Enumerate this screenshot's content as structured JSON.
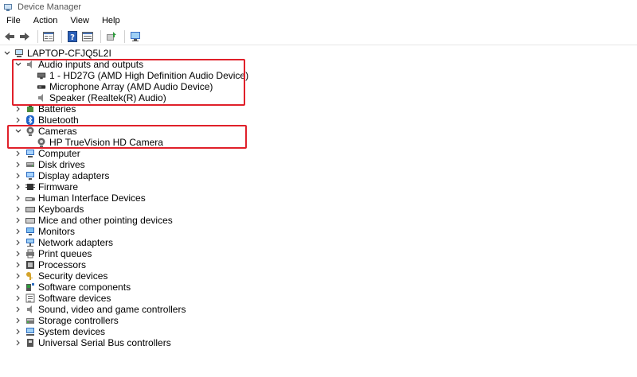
{
  "window": {
    "title": "Device Manager"
  },
  "menu": {
    "items": [
      "File",
      "Action",
      "View",
      "Help"
    ]
  },
  "toolbar": {
    "buttons": [
      "back-icon",
      "forward-icon",
      "properties-icon",
      "help-icon",
      "scan-icon",
      "update-driver-icon",
      "monitor-icon"
    ]
  },
  "tree": {
    "root": "LAPTOP-CFJQ5L2I",
    "audio": {
      "label": "Audio inputs and outputs",
      "children": [
        "1 - HD27G (AMD High Definition Audio Device)",
        "Microphone Array (AMD Audio Device)",
        "Speaker (Realtek(R) Audio)"
      ]
    },
    "batteries": "Batteries",
    "bluetooth": "Bluetooth",
    "cameras": {
      "label": "Cameras",
      "children": [
        "HP TrueVision HD Camera"
      ]
    },
    "categories": [
      "Computer",
      "Disk drives",
      "Display adapters",
      "Firmware",
      "Human Interface Devices",
      "Keyboards",
      "Mice and other pointing devices",
      "Monitors",
      "Network adapters",
      "Print queues",
      "Processors",
      "Security devices",
      "Software components",
      "Software devices",
      "Sound, video and game controllers",
      "Storage controllers",
      "System devices",
      "Universal Serial Bus controllers"
    ]
  },
  "colors": {
    "highlight": "#e0202a"
  }
}
